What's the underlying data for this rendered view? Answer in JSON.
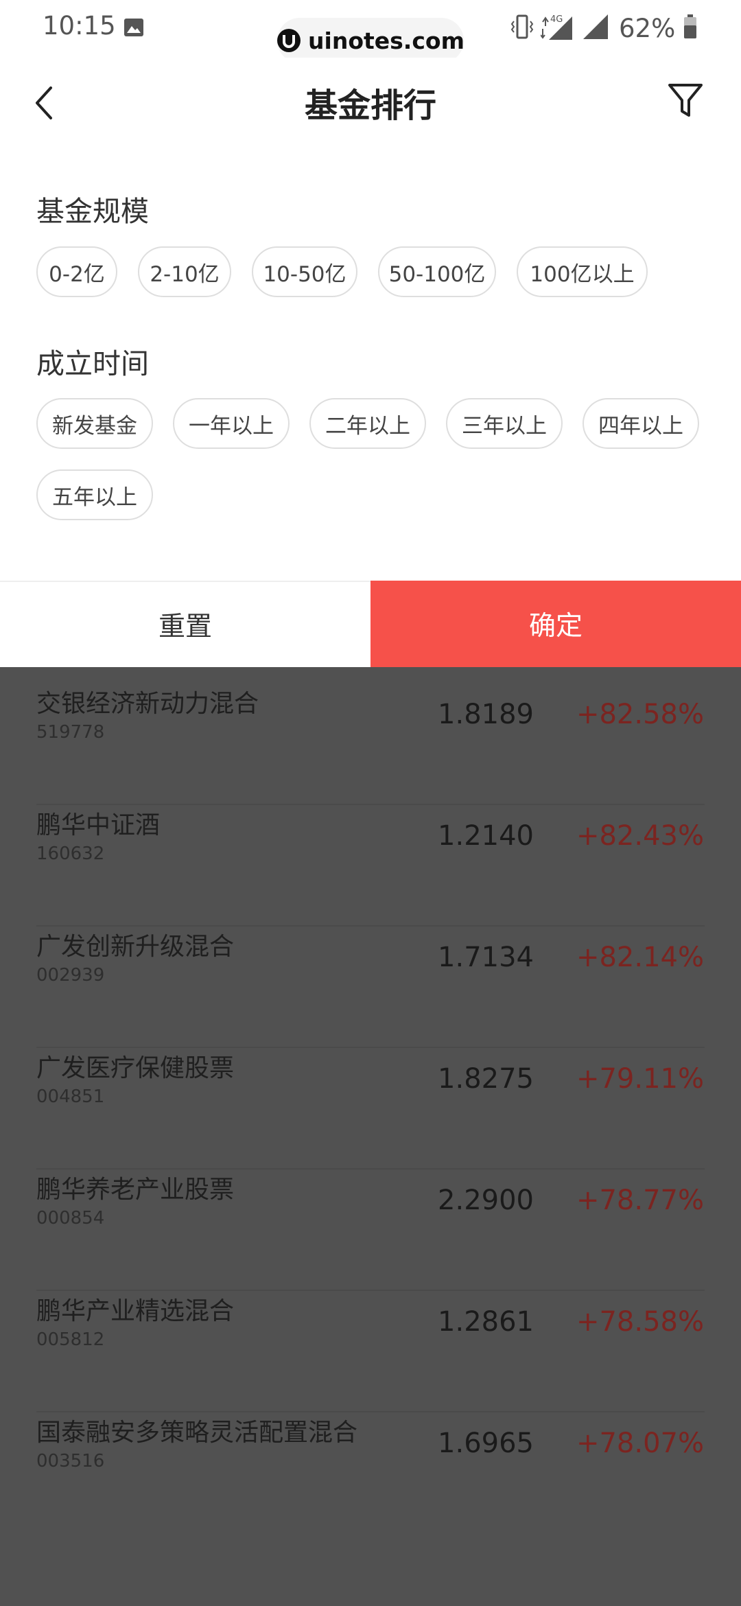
{
  "status_bar": {
    "time": "10:15",
    "watermark": "uinotes.com",
    "network": "4G",
    "battery": "62%"
  },
  "nav": {
    "title": "基金排行",
    "back_icon": "chevron-left-icon",
    "filter_icon": "funnel-icon"
  },
  "filters": {
    "scale": {
      "title": "基金规模",
      "options": [
        "0-2亿",
        "2-10亿",
        "10-50亿",
        "50-100亿",
        "100亿以上"
      ]
    },
    "established": {
      "title": "成立时间",
      "options": [
        "新发基金",
        "一年以上",
        "二年以上",
        "三年以上",
        "四年以上",
        "五年以上"
      ]
    }
  },
  "actions": {
    "reset_label": "重置",
    "confirm_label": "确定",
    "confirm_color": "#f6514a"
  },
  "funds": [
    {
      "name": "交银经济新动力混合",
      "code": "519778",
      "nav": "1.8189",
      "change": "+82.58%"
    },
    {
      "name": "鹏华中证酒",
      "code": "160632",
      "nav": "1.2140",
      "change": "+82.43%"
    },
    {
      "name": "广发创新升级混合",
      "code": "002939",
      "nav": "1.7134",
      "change": "+82.14%"
    },
    {
      "name": "广发医疗保健股票",
      "code": "004851",
      "nav": "1.8275",
      "change": "+79.11%"
    },
    {
      "name": "鹏华养老产业股票",
      "code": "000854",
      "nav": "2.2900",
      "change": "+78.77%"
    },
    {
      "name": "鹏华产业精选混合",
      "code": "005812",
      "nav": "1.2861",
      "change": "+78.58%"
    },
    {
      "name": "国泰融安多策略灵活配置混合",
      "code": "003516",
      "nav": "1.6965",
      "change": "+78.07%"
    }
  ]
}
